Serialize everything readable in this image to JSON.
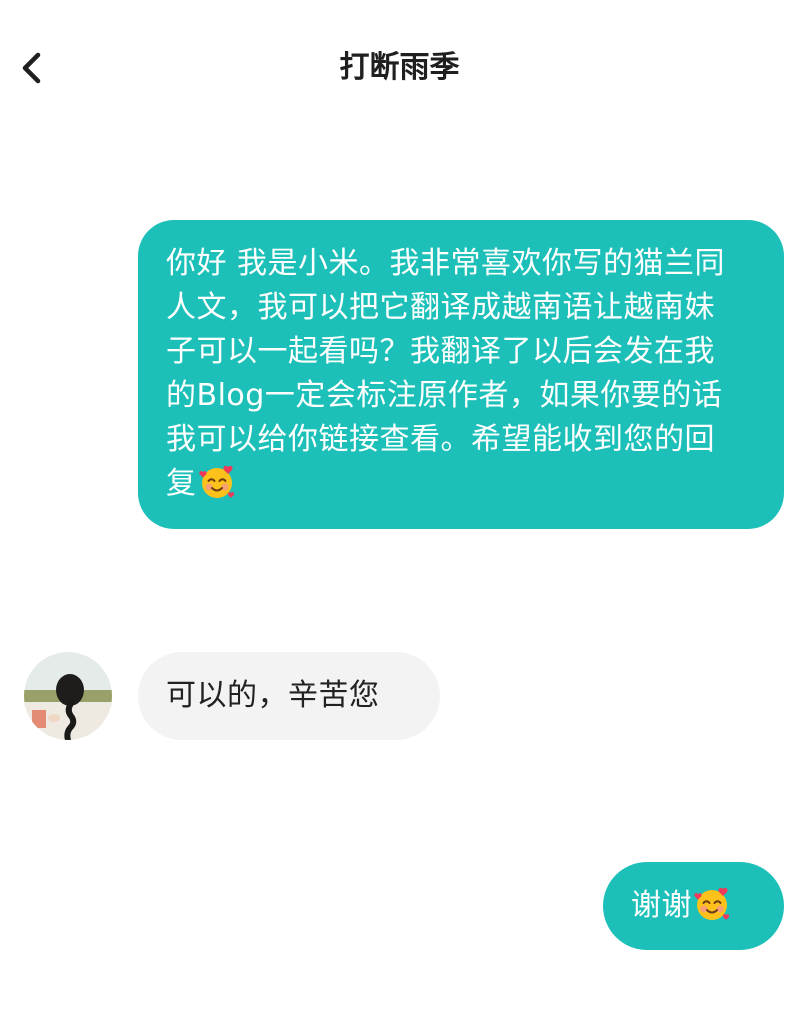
{
  "header": {
    "title": "打断雨季",
    "back_icon": "chevron-left-icon"
  },
  "messages": [
    {
      "direction": "outgoing",
      "text": "你好 我是小米。我非常喜欢你写的猫兰同人文，我可以把它翻译成越南语让越南妹子可以一起看吗？我翻译了以后会发在我的Blog一定会标注原作者，如果你要的话我可以给你链接查看。希望能收到您的回复",
      "emoji": "smiling-face-with-hearts"
    },
    {
      "direction": "incoming",
      "text": "可以的，辛苦您",
      "avatar": "girl-with-braid-avatar"
    },
    {
      "direction": "outgoing",
      "text": "谢谢",
      "emoji": "smiling-face-with-hearts"
    }
  ],
  "colors": {
    "outgoing_bubble": "#1cc0b8",
    "incoming_bubble": "#f3f3f3",
    "outgoing_text": "#ffffff",
    "incoming_text": "#222222"
  }
}
